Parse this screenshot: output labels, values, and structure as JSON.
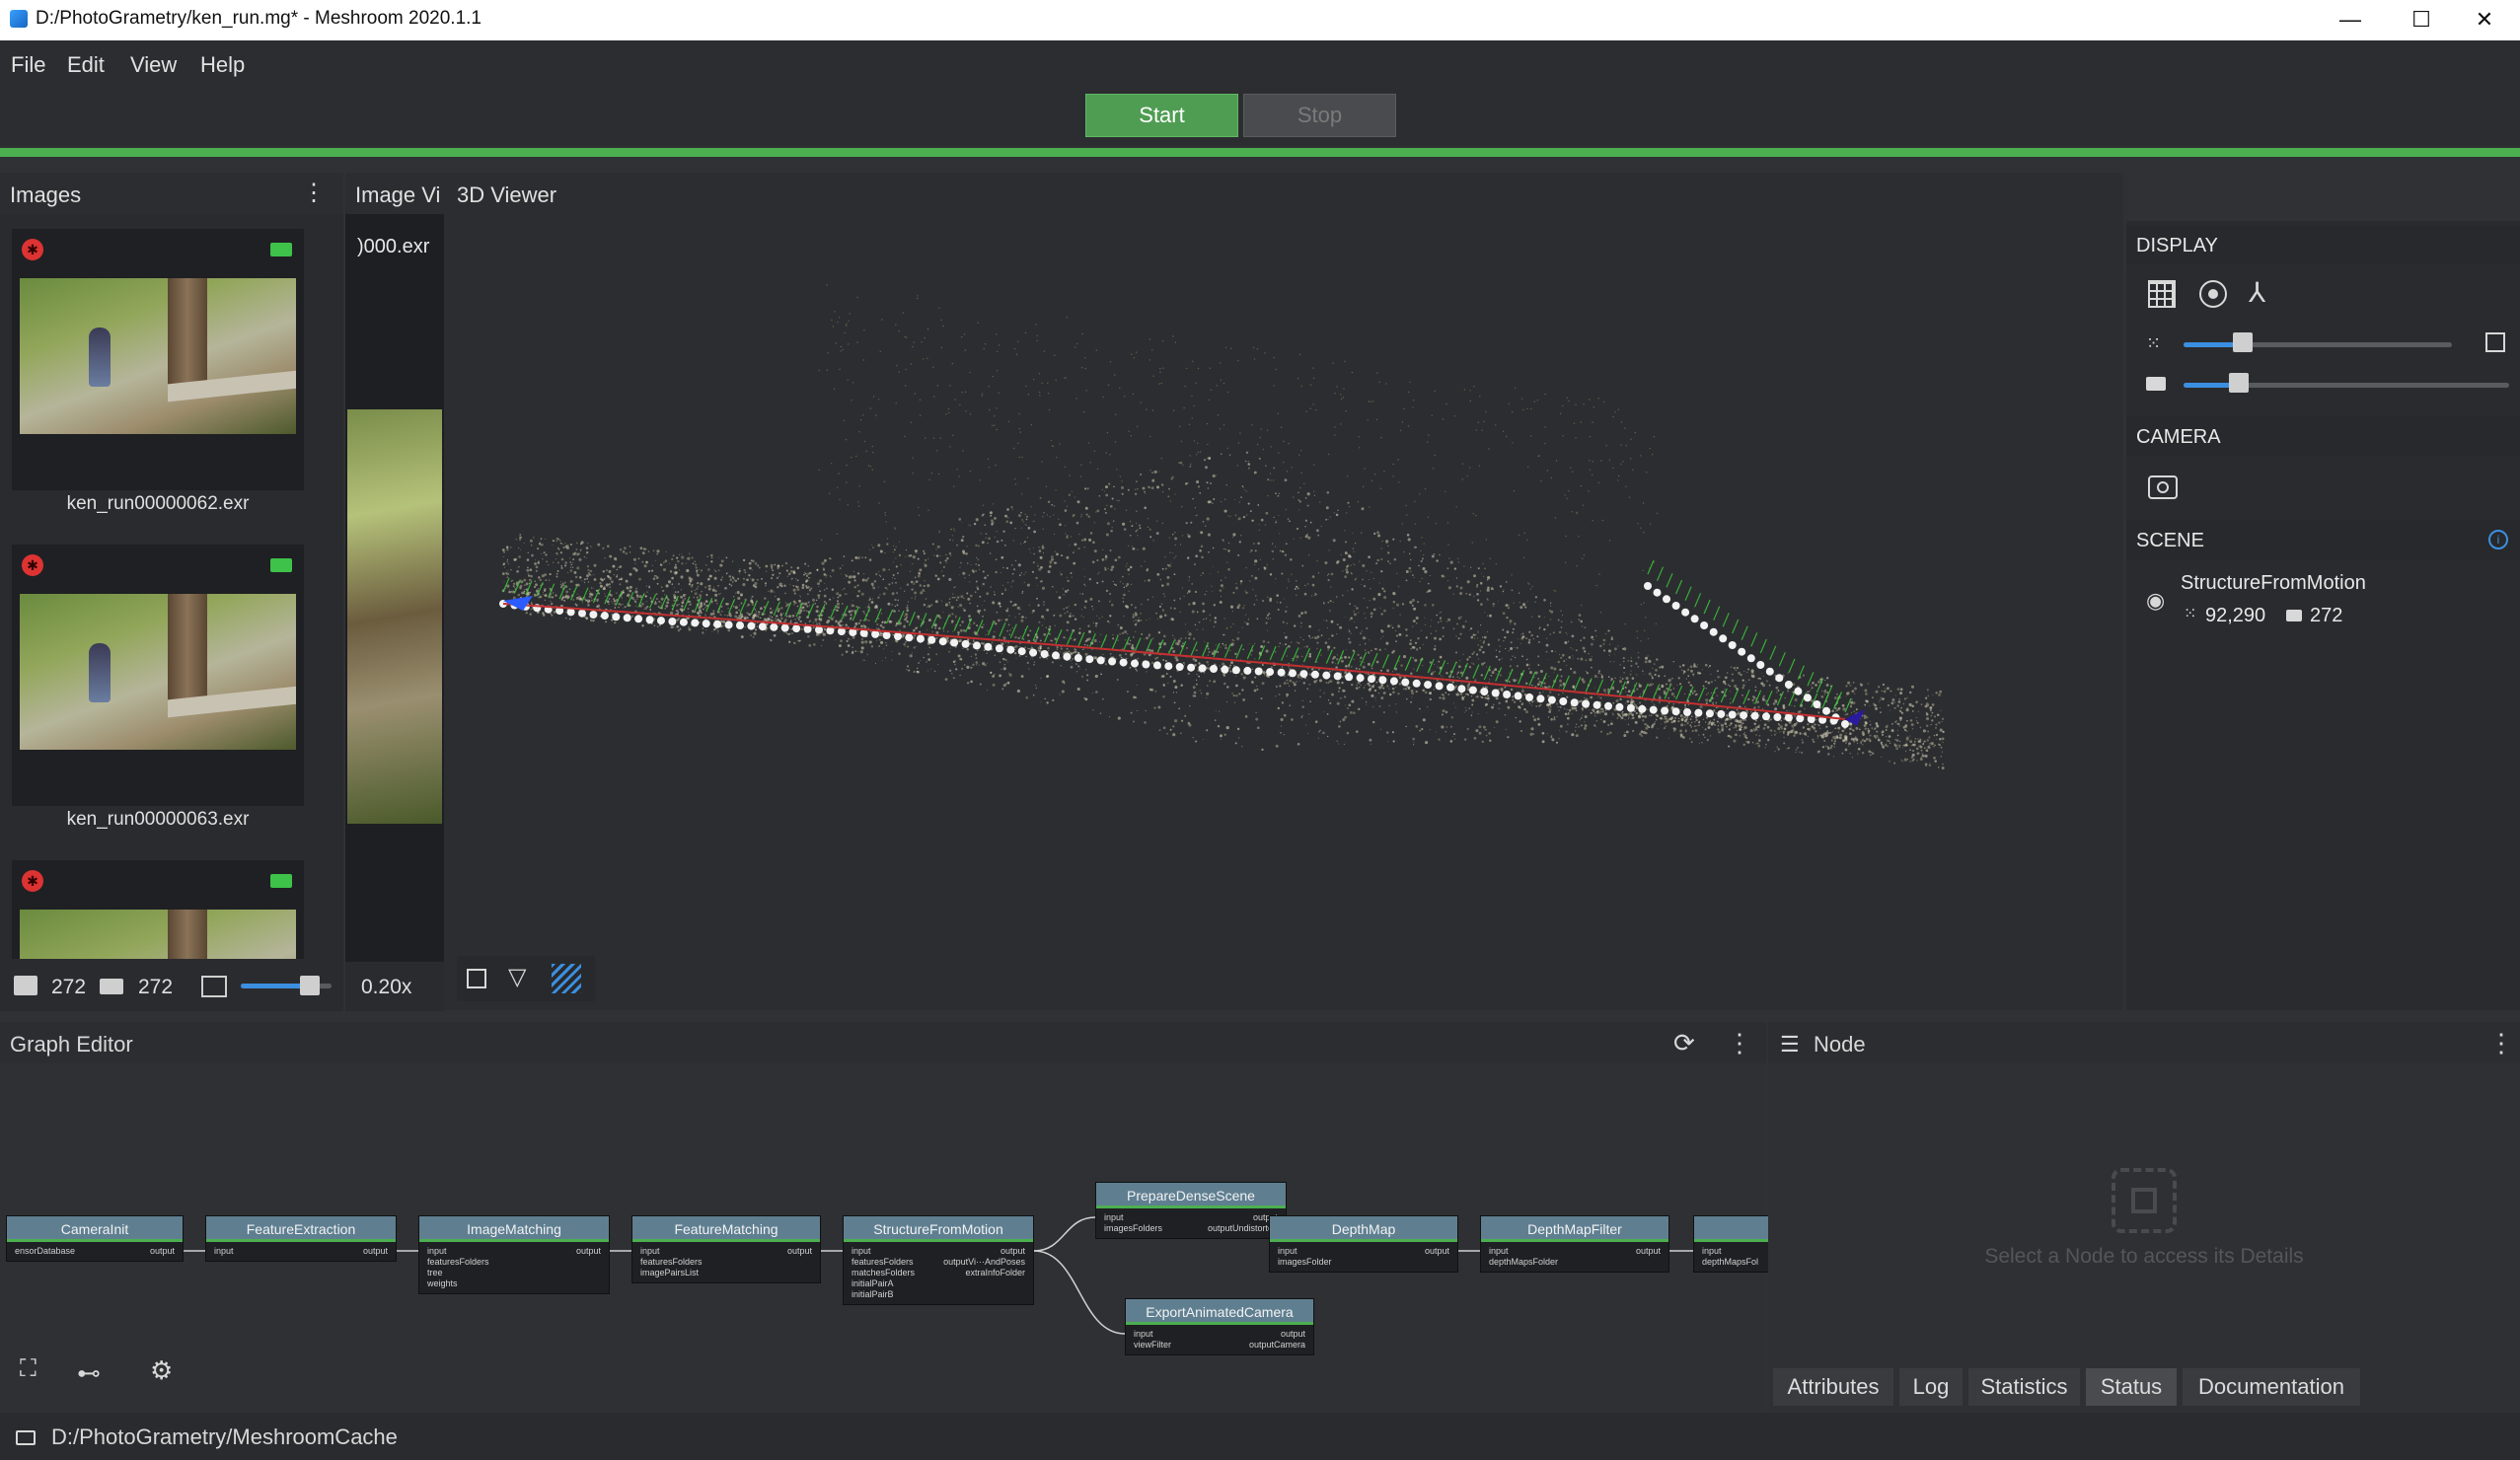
{
  "window": {
    "title": "D:/PhotoGrametry/ken_run.mg* - Meshroom 2020.1.1",
    "controls": {
      "minimize": "—",
      "maximize": "☐",
      "close": "✕"
    }
  },
  "menu": [
    "File",
    "Edit",
    "View",
    "Help"
  ],
  "toolbar": {
    "start_label": "Start",
    "stop_label": "Stop",
    "progress": 1.0
  },
  "images_panel": {
    "title": "Images",
    "thumbnails": [
      {
        "filename": "ken_run00000062.exr"
      },
      {
        "filename": "ken_run00000063.exr"
      }
    ],
    "image_count": "272",
    "camera_count": "272"
  },
  "image_viewer": {
    "title": "Image Vi",
    "filename": ")000.exr",
    "zoom": "0.20x"
  },
  "viewer3d": {
    "title": "3D Viewer"
  },
  "display_panel": {
    "display_header": "DISPLAY",
    "camera_header": "CAMERA",
    "scene_header": "SCENE",
    "point_size_level": 0.22,
    "camera_scale_level": 0.17,
    "scene_item": {
      "name": "StructureFromMotion",
      "points": "92,290",
      "cameras": "272"
    }
  },
  "graph_editor": {
    "title": "Graph Editor",
    "nodes": [
      {
        "name": "CameraInit",
        "inputs": [
          "ensorDatabase"
        ],
        "outputs": [
          "output"
        ]
      },
      {
        "name": "FeatureExtraction",
        "inputs": [
          "input"
        ],
        "outputs": [
          "output"
        ]
      },
      {
        "name": "ImageMatching",
        "inputs": [
          "input",
          "featuresFolders",
          "tree",
          "weights"
        ],
        "outputs": [
          "output"
        ]
      },
      {
        "name": "FeatureMatching",
        "inputs": [
          "input",
          "featuresFolders",
          "imagePairsList"
        ],
        "outputs": [
          "output"
        ]
      },
      {
        "name": "StructureFromMotion",
        "inputs": [
          "input",
          "featuresFolders",
          "matchesFolders",
          "initialPairA",
          "initialPairB"
        ],
        "outputs": [
          "output",
          "outputVi···AndPoses",
          "extraInfoFolder"
        ]
      },
      {
        "name": "PrepareDenseScene",
        "inputs": [
          "input",
          "imagesFolders"
        ],
        "outputs": [
          "output",
          "outputUndistorted"
        ]
      },
      {
        "name": "DepthMap",
        "inputs": [
          "input",
          "imagesFolder"
        ],
        "outputs": [
          "output"
        ]
      },
      {
        "name": "DepthMapFilter",
        "inputs": [
          "input",
          "depthMapsFolder"
        ],
        "outputs": [
          "output"
        ]
      },
      {
        "name": "ExportAnimatedCamera",
        "inputs": [
          "input",
          "viewFilter"
        ],
        "outputs": [
          "output",
          "outputCamera"
        ]
      },
      {
        "name": "",
        "inputs": [
          "input",
          "depthMapsFol"
        ],
        "outputs": []
      }
    ]
  },
  "node_panel": {
    "title": "Node",
    "placeholder": "Select a Node to access its Details",
    "tabs": [
      "Attributes",
      "Log",
      "Statistics",
      "Status",
      "Documentation"
    ]
  },
  "footer": {
    "cache_path": "D:/PhotoGrametry/MeshroomCache"
  },
  "colors": {
    "accent": "#4caf50",
    "blue": "#3b8fe0",
    "node_header": "#5f7f91"
  }
}
